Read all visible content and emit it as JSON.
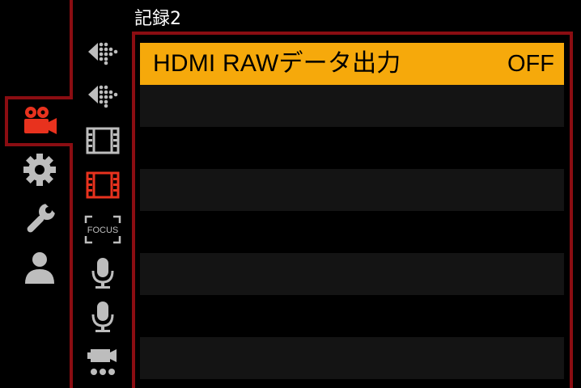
{
  "header": {
    "title": "記録2"
  },
  "categories": [
    {
      "name": "video-camera",
      "active": true,
      "color": "#e8321e"
    },
    {
      "name": "gear",
      "active": false,
      "color": "#bdbdbd"
    },
    {
      "name": "wrench",
      "active": false,
      "color": "#bdbdbd"
    },
    {
      "name": "person",
      "active": false,
      "color": "#bdbdbd"
    }
  ],
  "subtabs": [
    {
      "icon": "hdmi-dots-icon",
      "active": false
    },
    {
      "icon": "hdmi-dots-icon",
      "active": false
    },
    {
      "icon": "film-icon",
      "active": false
    },
    {
      "icon": "film-icon",
      "active": true
    },
    {
      "icon": "focus-icon",
      "label": "FOCUS",
      "active": false
    },
    {
      "icon": "microphone-icon",
      "active": false
    },
    {
      "icon": "microphone-icon",
      "active": false
    },
    {
      "icon": "camera-dots-icon",
      "active": false
    }
  ],
  "menu": {
    "items": [
      {
        "label": "HDMI RAWデータ出力",
        "value": "OFF",
        "selected": true
      },
      {
        "label": "",
        "value": ""
      },
      {
        "label": "",
        "value": ""
      },
      {
        "label": "",
        "value": ""
      },
      {
        "label": "",
        "value": ""
      },
      {
        "label": "",
        "value": ""
      },
      {
        "label": "",
        "value": ""
      }
    ]
  },
  "colors": {
    "accent": "#f6a90b",
    "frame": "#8b0d12",
    "active_icon": "#e8321e",
    "icon": "#bdbdbd"
  }
}
